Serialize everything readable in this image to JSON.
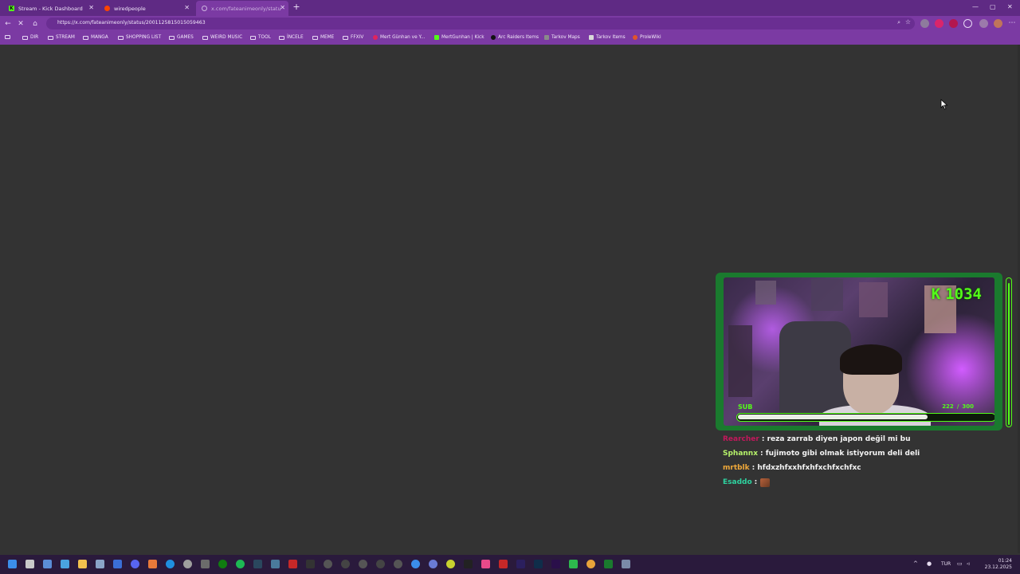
{
  "browser": {
    "tabs": [
      {
        "title": "Stream - Kick Dashboard",
        "favicon": "kick-icon",
        "active": false
      },
      {
        "title": "wiredpeople",
        "favicon": "reddit-icon",
        "active": false
      },
      {
        "title": "x.com/fateanimeonly/status/200",
        "favicon": "loading-icon",
        "active": true
      }
    ],
    "url": "https://x.com/fateanimeonly/status/2001125815015059463",
    "bookmarks": [
      "DIR",
      "STREAM",
      "MANGA",
      "SHOPPING LIST",
      "GAMES",
      "WEIRD MUSIC",
      "TOOL",
      "İNCELE",
      "MEME",
      "FFXIV",
      "Mert Günhan ve Y...",
      "MertGunhan | Kick",
      "Arc Raiders Items",
      "Tarkov Maps",
      "Tarkov Items",
      "ProleWiki"
    ]
  },
  "overlay": {
    "kick_count": "1034",
    "kick_logo": "K",
    "sub_label": "SUB",
    "sub_current": "222",
    "sub_sep": "/",
    "sub_goal": "300",
    "sub_progress": 0.74,
    "vbar_progress": 0.98,
    "colors": {
      "accent": "#53fc18",
      "frame": "#1a7a2e"
    }
  },
  "chat": [
    {
      "user": "Rearcher",
      "color": "#c2185b",
      "text": "reza zarrab diyen japon değil mi bu"
    },
    {
      "user": "Sphannx",
      "color": "#b6f26a",
      "text": "fujimoto gibi olmak istiyorum deli deli"
    },
    {
      "user": "mrtblk",
      "color": "#f0a93a",
      "text": "hfdxzhfxxhfxhfxchfxchfxc"
    },
    {
      "user": "Esaddo",
      "color": "#2ed3a0",
      "text": "",
      "emote": true
    }
  ],
  "taskbar": {
    "time": "01:24",
    "date": "23.12.2025",
    "lang": "TUR"
  }
}
